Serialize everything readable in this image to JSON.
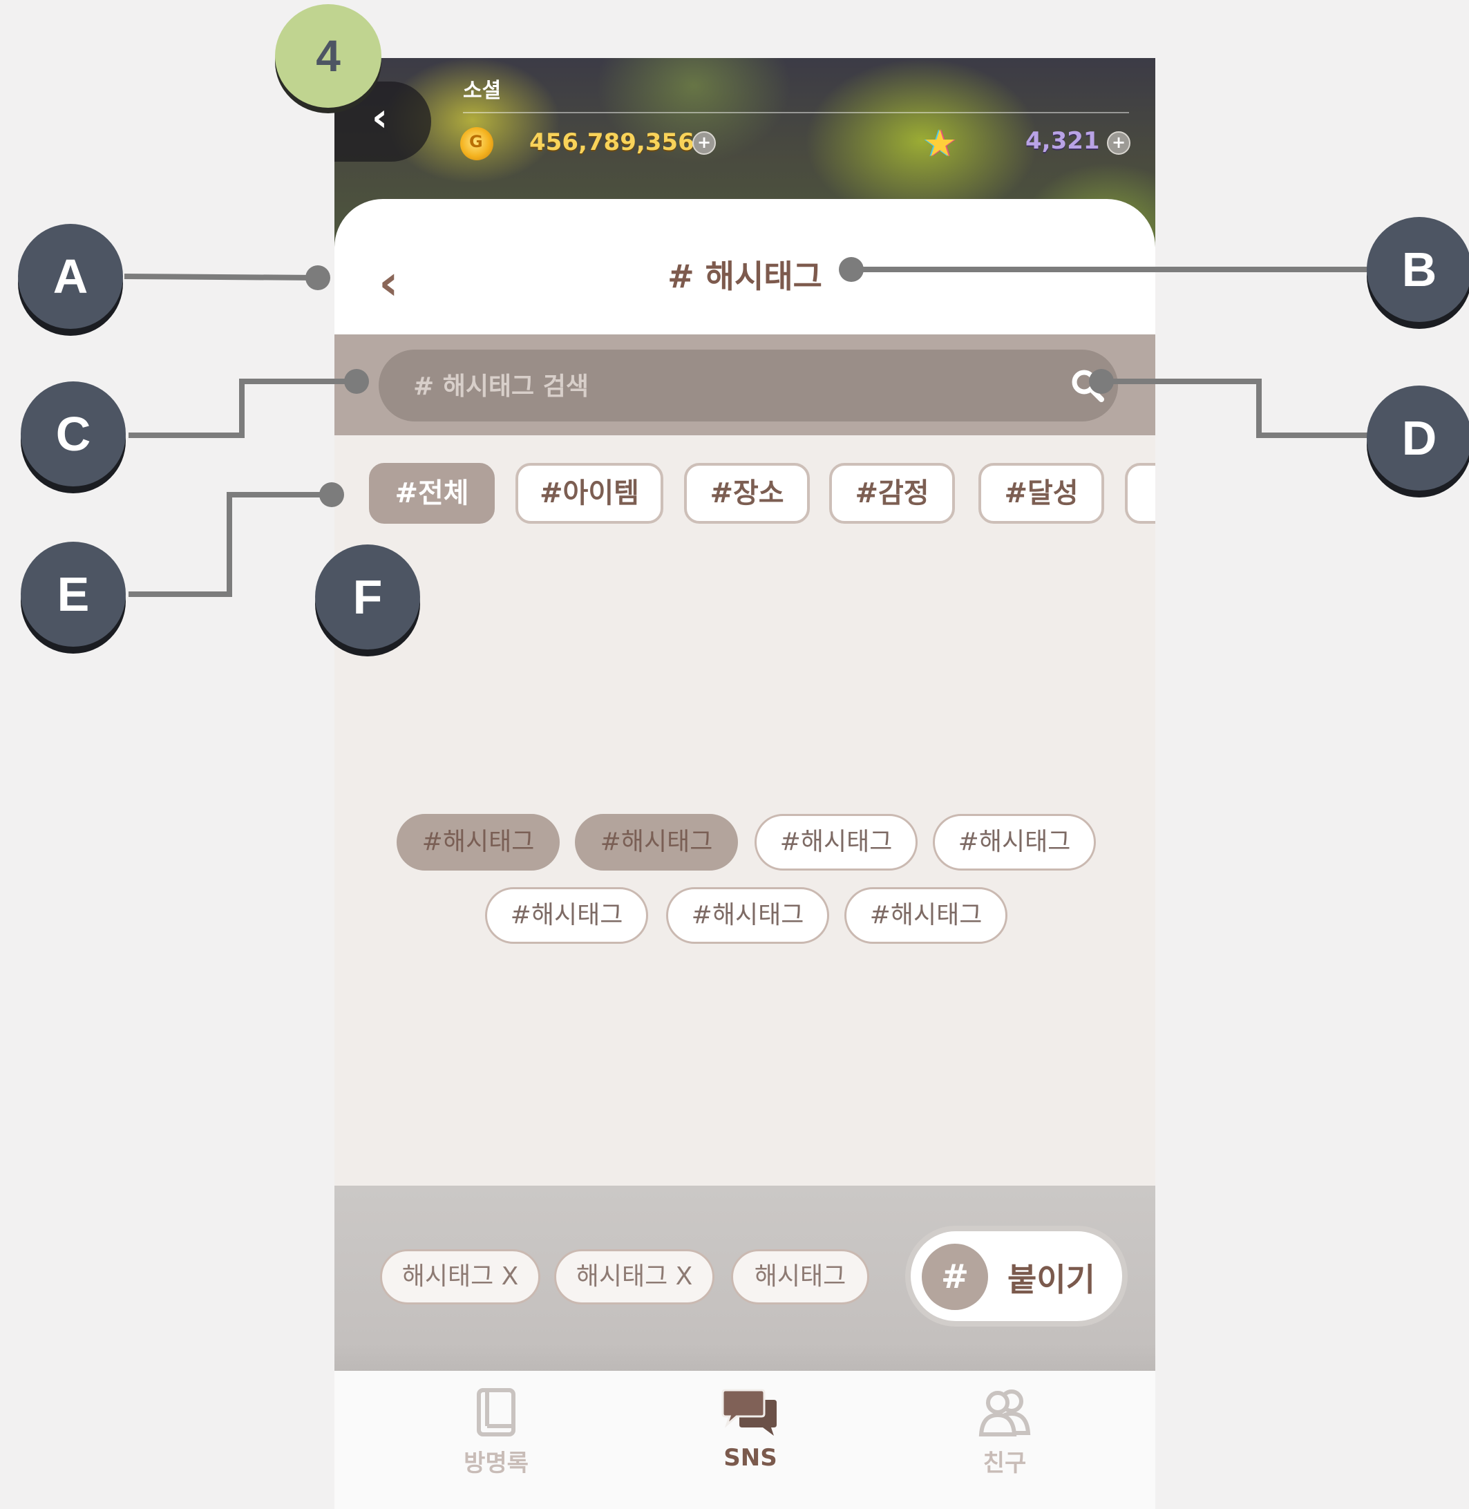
{
  "top_bar": {
    "back_glyph": "‹",
    "title": "소셜",
    "coin_value": "456,789,356",
    "star_value": "4,321",
    "plus_glyph": "+"
  },
  "header": {
    "back_glyph": "‹",
    "title": "# 해시태그"
  },
  "search": {
    "placeholder": "# 해시태그 검색"
  },
  "categories": [
    "#전체",
    "#아이템",
    "#장소",
    "#감정",
    "#달성"
  ],
  "hashtags": {
    "row1": [
      "#해시태그",
      "#해시태그",
      "#해시태그",
      "#해시태그"
    ],
    "row2": [
      "#해시태그",
      "#해시태그",
      "#해시태그"
    ]
  },
  "selected_tags": [
    "해시태그 X",
    "해시태그 X",
    "해시태그"
  ],
  "attach": {
    "hash_glyph": "#",
    "label": "붙이기"
  },
  "bottom_nav": [
    {
      "label": "방명록",
      "icon": "book-icon"
    },
    {
      "label": "SNS",
      "icon": "chat-icon"
    },
    {
      "label": "친구",
      "icon": "friends-icon"
    }
  ],
  "callouts": [
    "4",
    "A",
    "B",
    "C",
    "D",
    "E",
    "F"
  ],
  "colors": {
    "accent_brown": "#7d5a4d",
    "chip_active": "#b0a19a",
    "callout_dark": "#4d5563",
    "callout_green": "#c0d490"
  }
}
